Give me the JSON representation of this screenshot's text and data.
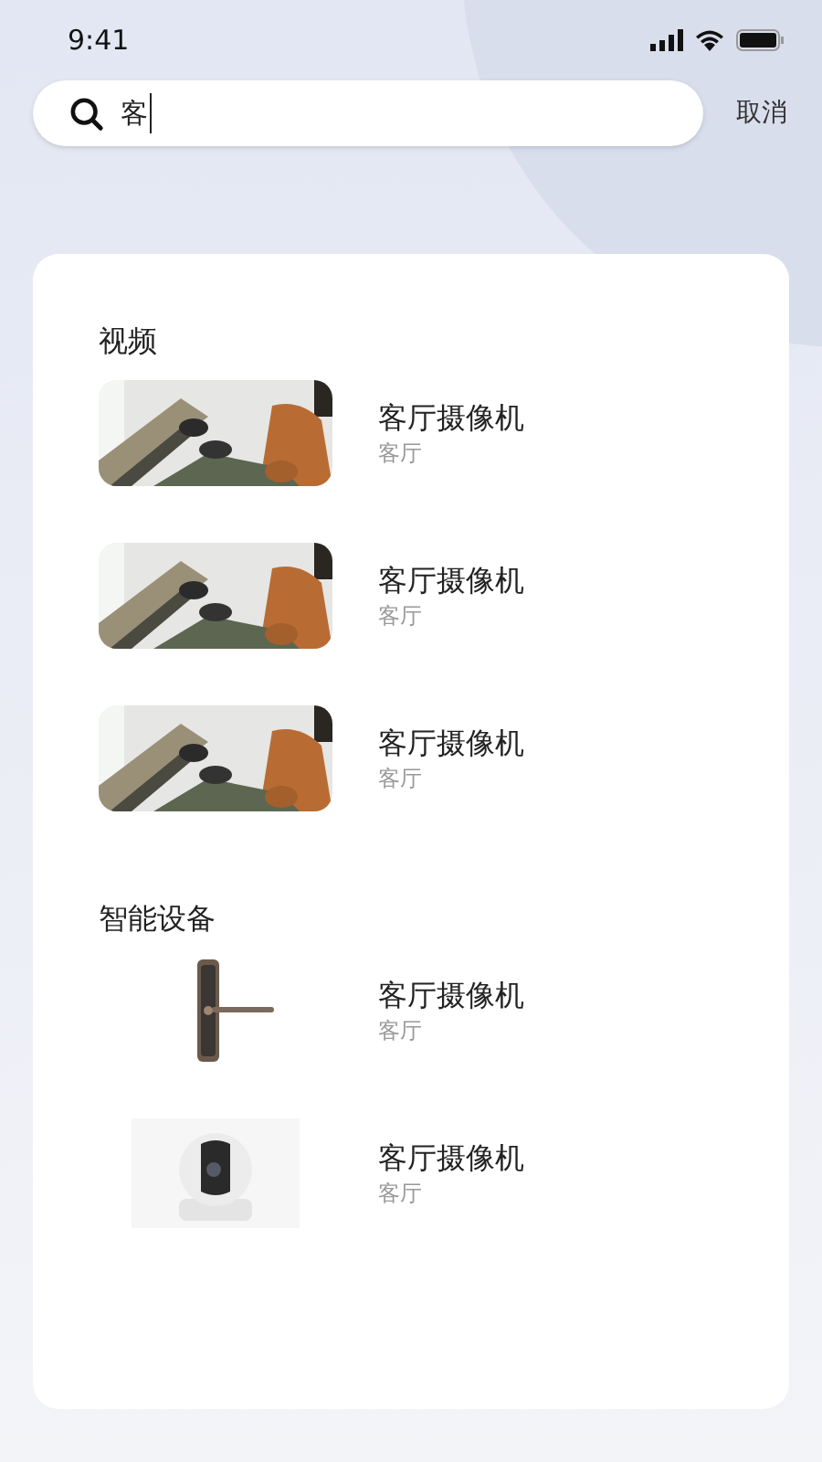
{
  "status_bar": {
    "time": "9:41"
  },
  "search": {
    "value": "客",
    "cancel": "取消"
  },
  "sections": [
    {
      "title": "视频",
      "items": [
        {
          "kind": "video",
          "title": "客厅摄像机",
          "subtitle": "客厅"
        },
        {
          "kind": "video",
          "title": "客厅摄像机",
          "subtitle": "客厅"
        },
        {
          "kind": "video",
          "title": "客厅摄像机",
          "subtitle": "客厅"
        }
      ]
    },
    {
      "title": "智能设备",
      "items": [
        {
          "kind": "lock",
          "title": "客厅摄像机",
          "subtitle": "客厅"
        },
        {
          "kind": "camera",
          "title": "客厅摄像机",
          "subtitle": "客厅"
        }
      ]
    }
  ]
}
